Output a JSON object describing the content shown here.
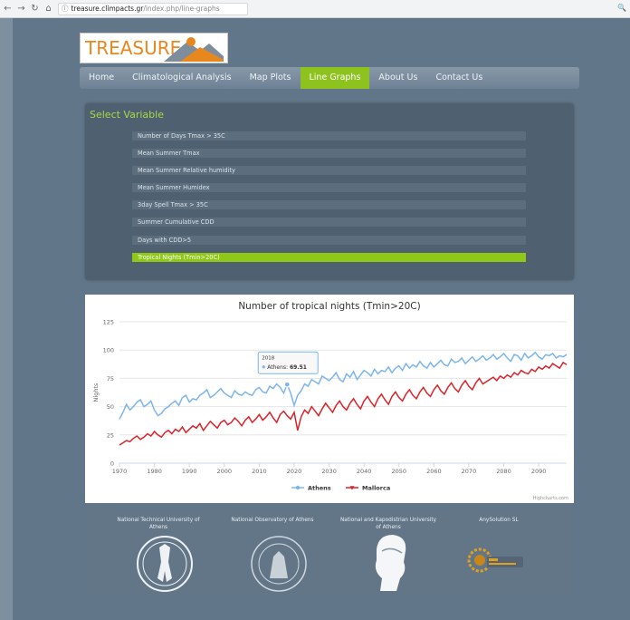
{
  "browser": {
    "url_host": "treasure.climpacts.gr",
    "url_path": "/index.php/line-graphs"
  },
  "logo": {
    "text": "TREASURE",
    "badge": "TREASURE"
  },
  "nav": {
    "items": [
      {
        "label": "Home"
      },
      {
        "label": "Climatological Analysis"
      },
      {
        "label": "Map Plots"
      },
      {
        "label": "Line Graphs"
      },
      {
        "label": "About Us"
      },
      {
        "label": "Contact Us"
      }
    ],
    "active_index": 3
  },
  "select_variable": {
    "title": "Select Variable",
    "items": [
      "Number of Days Tmax > 35C",
      "Mean Summer Tmax",
      "Mean Summer Relative humidity",
      "Mean Summer Humidex",
      "3day Spell Tmax > 35C",
      "Summer Cumulative CDD",
      "Days with CDD>5",
      "Tropical Nights (Tmin>20C)"
    ],
    "active_index": 7
  },
  "chart_data": {
    "type": "line",
    "title": "Number of tropical nights (Tmin>20C)",
    "ylabel": "Nights",
    "ylim": [
      0,
      125
    ],
    "yticks": [
      0,
      25,
      50,
      75,
      100,
      125
    ],
    "xlim": [
      1970,
      2098
    ],
    "xticks": [
      1970,
      1980,
      1990,
      2000,
      2010,
      2020,
      2030,
      2040,
      2050,
      2060,
      2070,
      2080,
      2090
    ],
    "tooltip": {
      "year": "2018",
      "series": "Athens",
      "value": "69.51"
    },
    "credits": "Highcharts.com",
    "legend_position": "bottom-center",
    "colors": {
      "Athens": "#7cb5ec",
      "Mallorca": "#d9232a"
    },
    "series": [
      {
        "name": "Athens",
        "start_year": 1970,
        "values": [
          39,
          45,
          52,
          47,
          50,
          54,
          56,
          50,
          52,
          55,
          47,
          42,
          44,
          48,
          50,
          53,
          55,
          51,
          58,
          60,
          54,
          57,
          56,
          60,
          62,
          65,
          58,
          60,
          63,
          66,
          62,
          60,
          58,
          64,
          61,
          60,
          63,
          61,
          60,
          65,
          67,
          63,
          62,
          68,
          66,
          70,
          67,
          62,
          69.51,
          62,
          51,
          60,
          64,
          70,
          68,
          74,
          72,
          70,
          77,
          75,
          73,
          76,
          80,
          74,
          72,
          79,
          76,
          81,
          74,
          78,
          82,
          80,
          77,
          83,
          79,
          82,
          81,
          85,
          80,
          84,
          86,
          82,
          88,
          84,
          87,
          85,
          90,
          86,
          84,
          89,
          85,
          88,
          91,
          87,
          86,
          92,
          89,
          90,
          93,
          88,
          91,
          94,
          90,
          92,
          95,
          91,
          93,
          96,
          92,
          94,
          97,
          93,
          90,
          96,
          95,
          91,
          97,
          93,
          95,
          98,
          94,
          92,
          96,
          95,
          97,
          93,
          95,
          94,
          96
        ]
      },
      {
        "name": "Mallorca",
        "start_year": 1970,
        "values": [
          16,
          18,
          20,
          19,
          22,
          24,
          21,
          23,
          26,
          24,
          28,
          25,
          23,
          27,
          29,
          26,
          30,
          28,
          32,
          27,
          30,
          33,
          31,
          35,
          29,
          33,
          37,
          34,
          31,
          36,
          38,
          34,
          36,
          40,
          37,
          33,
          38,
          41,
          36,
          39,
          43,
          38,
          41,
          45,
          40,
          36,
          43,
          46,
          42,
          39,
          45,
          29,
          41,
          47,
          44,
          50,
          46,
          42,
          48,
          53,
          49,
          45,
          51,
          55,
          50,
          47,
          53,
          57,
          52,
          48,
          55,
          59,
          54,
          50,
          57,
          61,
          56,
          52,
          59,
          63,
          58,
          55,
          61,
          65,
          60,
          57,
          63,
          67,
          62,
          59,
          65,
          69,
          64,
          61,
          67,
          71,
          66,
          63,
          69,
          73,
          68,
          65,
          71,
          75,
          70,
          72,
          74,
          76,
          73,
          77,
          75,
          78,
          76,
          80,
          78,
          82,
          80,
          79,
          83,
          81,
          85,
          83,
          86,
          84,
          88,
          86,
          84,
          89,
          87
        ]
      }
    ]
  },
  "footer": {
    "institutions": [
      "National Technical University of Athens",
      "National Observatory of Athens",
      "National and Kapodistrian University of Athens",
      "AnySolution SL"
    ]
  }
}
